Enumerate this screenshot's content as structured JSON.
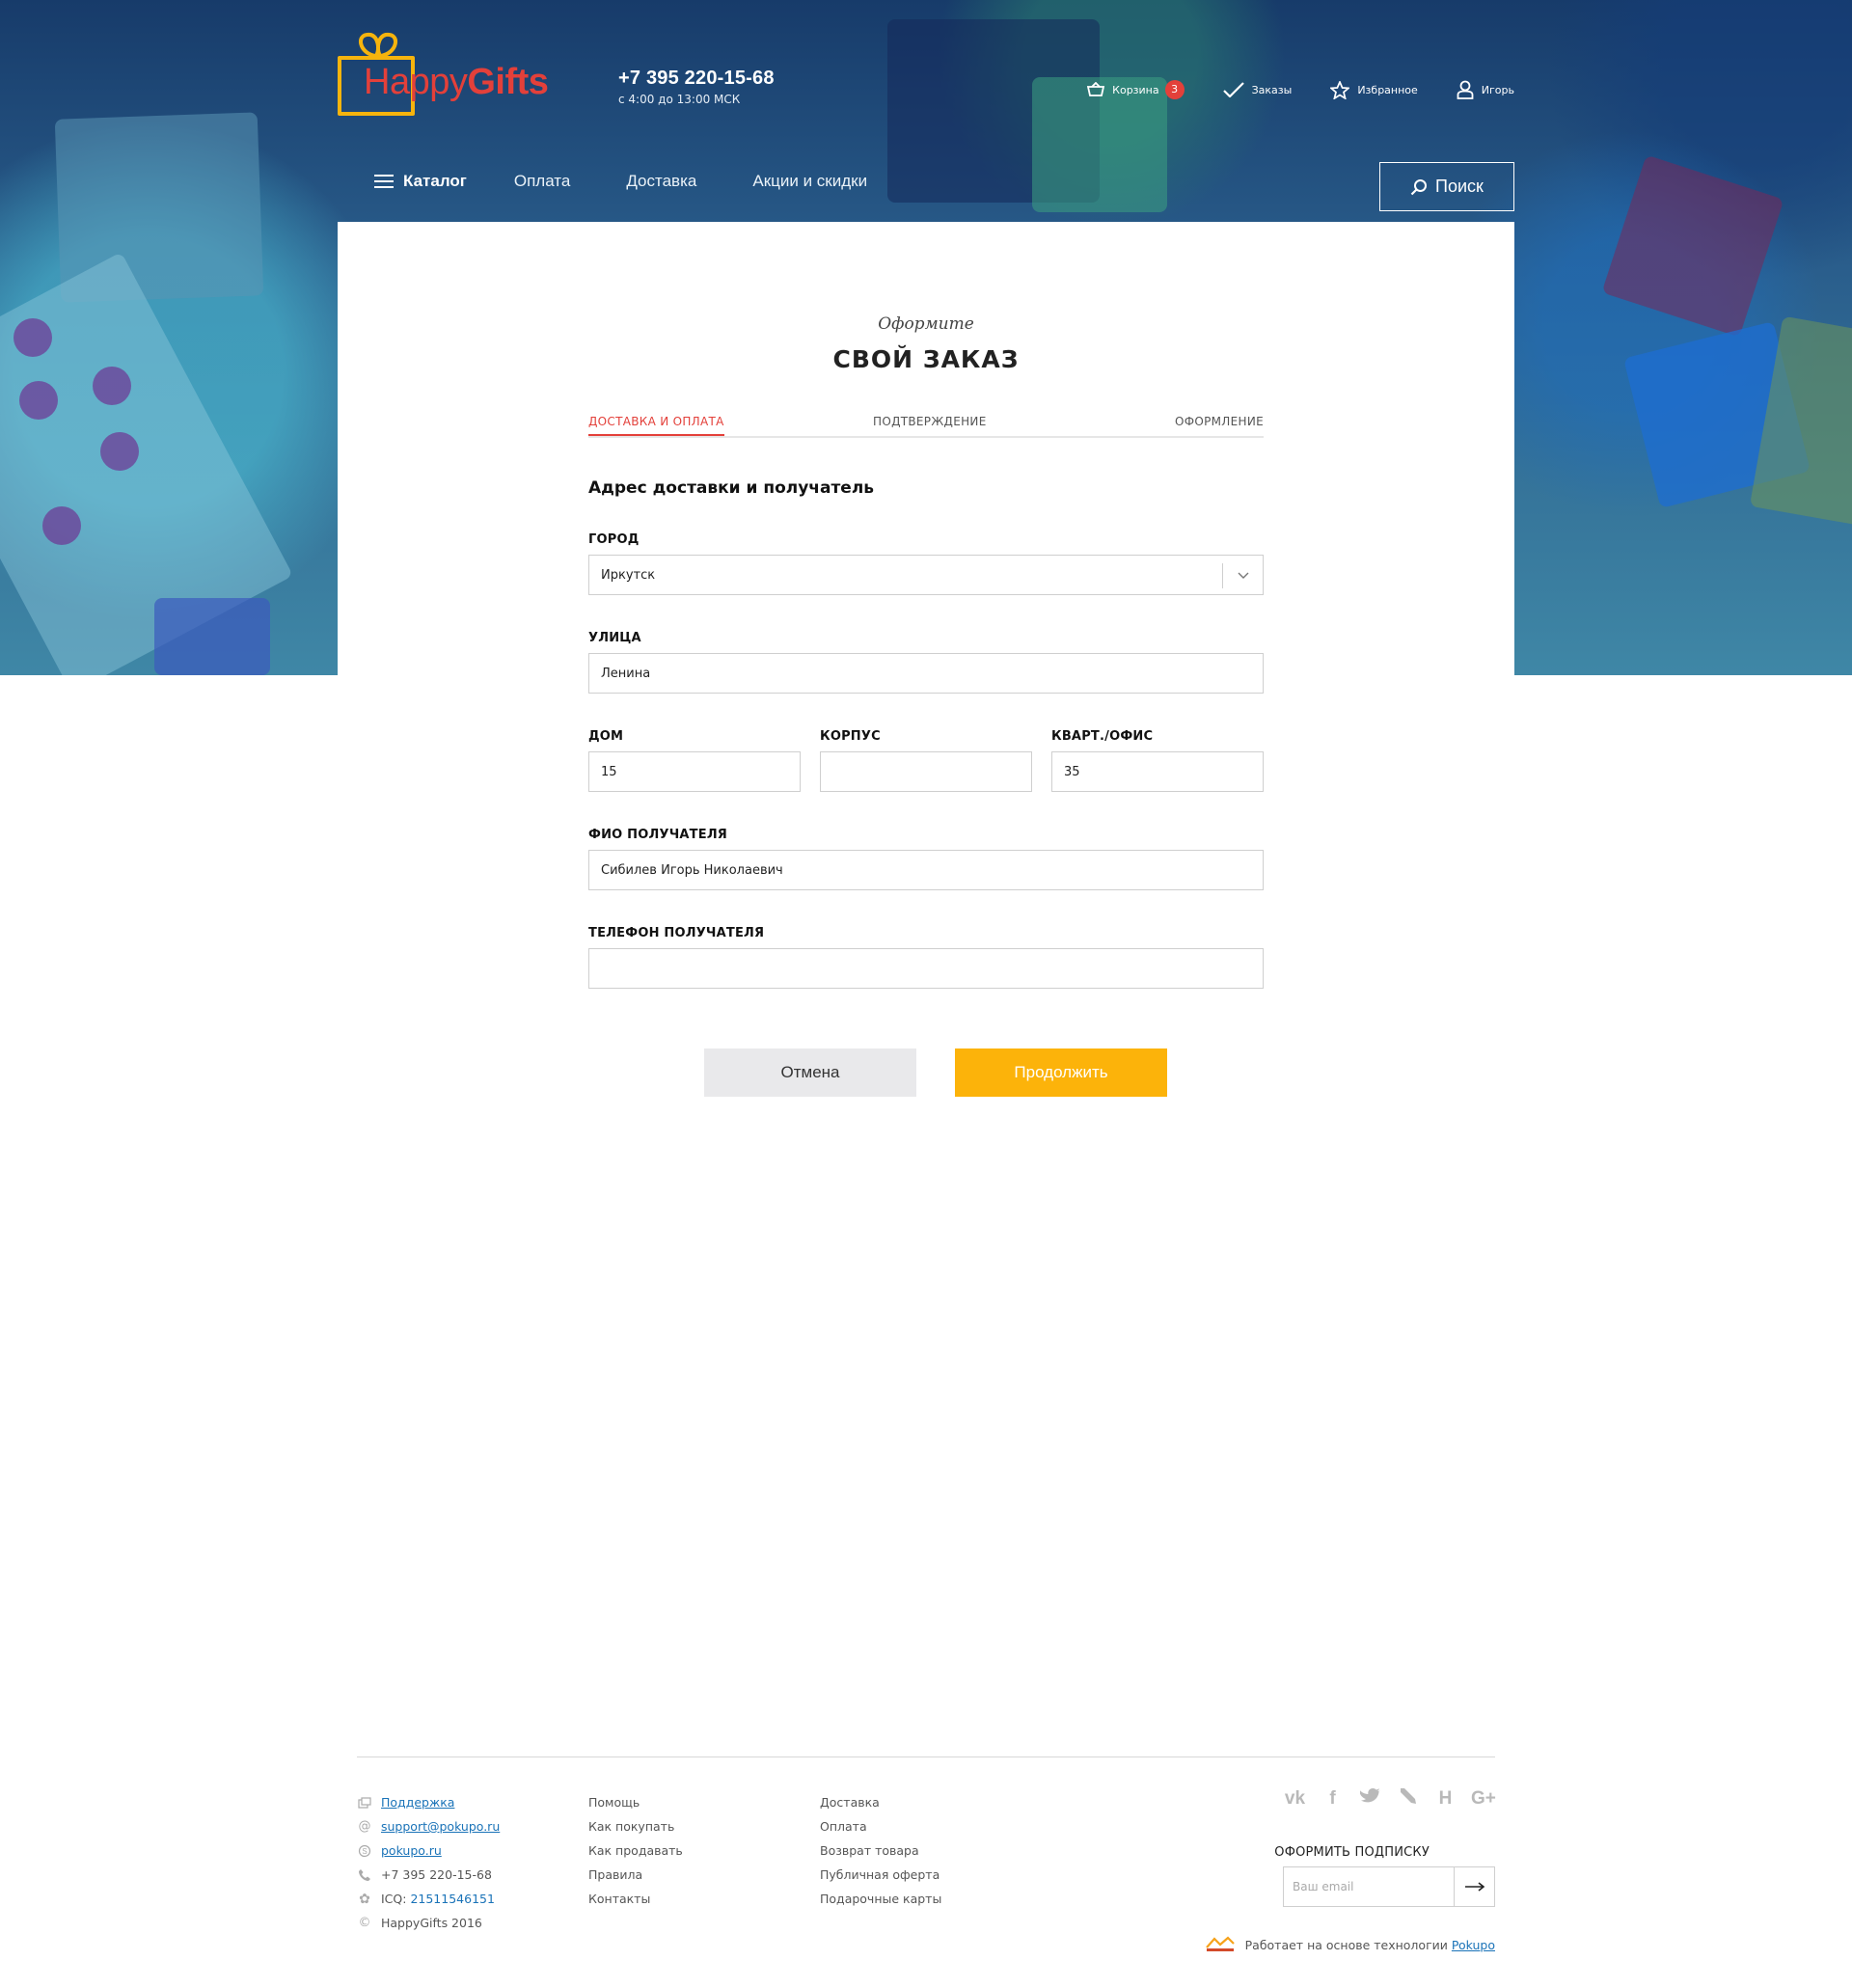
{
  "header": {
    "logo": {
      "part1": "Happy",
      "part2": "Gifts"
    },
    "phone": {
      "number": "+7 395 220-15-68",
      "hours": "с 4:00 до 13:00 МСК"
    },
    "user_nav": {
      "cart_label": "Корзина",
      "cart_count": "3",
      "orders_label": "Заказы",
      "favorites_label": "Избранное",
      "user_label": "Игорь"
    },
    "nav": {
      "catalog": "Каталог",
      "items": [
        "Оплата",
        "Доставка",
        "Акции и скидки"
      ],
      "search": "Поиск"
    }
  },
  "checkout": {
    "subtitle": "Оформите",
    "title": "СВОЙ ЗАКАЗ",
    "steps": [
      {
        "label": "ДОСТАВКА И ОПЛАТА",
        "active": true
      },
      {
        "label": "ПОДТВЕРЖДЕНИЕ",
        "active": false
      },
      {
        "label": "ОФОРМЛЕНИЕ",
        "active": false
      }
    ],
    "section_title": "Адрес доставки и получатель",
    "fields": {
      "city": {
        "label": "ГОРОД",
        "value": "Иркутск"
      },
      "street": {
        "label": "УЛИЦА",
        "value": "Ленина"
      },
      "house": {
        "label": "ДОМ",
        "value": "15"
      },
      "building": {
        "label": "КОРПУС",
        "value": ""
      },
      "apartment": {
        "label": "КВАРТ./ОФИС",
        "value": "35"
      },
      "recipient": {
        "label": "ФИО ПОЛУЧАТЕЛЯ",
        "value": "Сибилев Игорь Николаевич"
      },
      "phone": {
        "label": "ТЕЛЕФОН ПОЛУЧАТЕЛЯ",
        "value": ""
      }
    },
    "buttons": {
      "cancel": "Отмена",
      "continue": "Продолжить"
    }
  },
  "footer": {
    "contacts": {
      "support": "Поддержка",
      "email": "support@pokupo.ru",
      "skype": "pokupo.ru",
      "phone": "+7 395 220-15-68",
      "icq_label": "ICQ:",
      "icq_number": "21511546151",
      "copyright": "HappyGifts 2016"
    },
    "col2": [
      "Помощь",
      "Как покупать",
      "Как продавать",
      "Правила",
      "Контакты"
    ],
    "col3": [
      "Доставка",
      "Оплата",
      "Возврат товара",
      "Публичная оферта",
      "Подарочные карты"
    ],
    "socials": [
      "vk-icon",
      "facebook-icon",
      "twitter-icon",
      "livejournal-icon",
      "habr-icon",
      "google-plus-icon"
    ],
    "subscribe": {
      "title": "ОФОРМИТЬ ПОДПИСКУ",
      "placeholder": "Ваш email"
    },
    "powered": {
      "text": "Работает на основе технологии",
      "link": "Pokupo"
    }
  },
  "colors": {
    "accent_red": "#e3403a",
    "accent_yellow": "#fcb30a",
    "link_blue": "#1a73b8"
  }
}
